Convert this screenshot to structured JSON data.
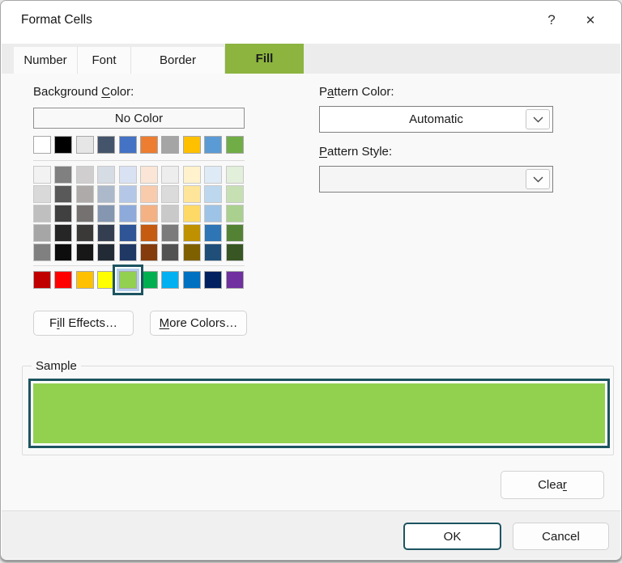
{
  "window": {
    "title": "Format Cells",
    "help_glyph": "?",
    "close_glyph": "✕"
  },
  "tabs": [
    {
      "label": "Number",
      "active": false
    },
    {
      "label": "Font",
      "active": false
    },
    {
      "label": "Border",
      "active": false
    },
    {
      "label": "Fill",
      "active": true
    }
  ],
  "fill_tab": {
    "background_color_label": {
      "pre": "Background ",
      "key": "C",
      "post": "olor:"
    },
    "no_color_label": "No Color",
    "palette": {
      "theme_row": [
        "#FFFFFF",
        "#000000",
        "#E7E6E6",
        "#44546A",
        "#4472C4",
        "#ED7D31",
        "#A5A5A5",
        "#FFC000",
        "#5B9BD5",
        "#70AD47"
      ],
      "variant_rows": [
        [
          "#F2F2F2",
          "#808080",
          "#D0CECE",
          "#D6DCE4",
          "#D9E2F3",
          "#FBE5D6",
          "#EDEDED",
          "#FFF2CC",
          "#DEEBF7",
          "#E2EFDA"
        ],
        [
          "#D9D9D9",
          "#595959",
          "#AEAAAA",
          "#ACB9CA",
          "#B4C7E7",
          "#F8CBAD",
          "#DBDBDB",
          "#FFE599",
          "#BDD7EE",
          "#C6E0B4"
        ],
        [
          "#BFBFBF",
          "#404040",
          "#757171",
          "#8496B0",
          "#8EAADB",
          "#F4B183",
          "#C9C9C9",
          "#FFD966",
          "#9DC3E6",
          "#A9D08E"
        ],
        [
          "#A6A6A6",
          "#262626",
          "#3B3838",
          "#333F50",
          "#2F5597",
          "#C55A11",
          "#7B7B7B",
          "#BF9000",
          "#2E75B6",
          "#548235"
        ],
        [
          "#808080",
          "#0D0D0D",
          "#171717",
          "#222B35",
          "#1F3864",
          "#843C0C",
          "#525252",
          "#7F6000",
          "#1F4E79",
          "#375623"
        ]
      ],
      "standard_row": [
        "#C00000",
        "#FF0000",
        "#FFC000",
        "#FFFF00",
        "#92D050",
        "#00B050",
        "#00B0F0",
        "#0070C0",
        "#002060",
        "#7030A0"
      ],
      "selected_standard_index": 4,
      "selected_color": "#92D050"
    },
    "fill_effects_label": {
      "pre": "F",
      "key": "i",
      "post": "ll Effects…"
    },
    "more_colors_label": {
      "pre": "",
      "key": "M",
      "post": "ore Colors…"
    },
    "pattern_color_label": {
      "pre": "P",
      "key": "a",
      "post": "ttern Color:"
    },
    "pattern_color_value": "Automatic",
    "pattern_style_label": {
      "pre": "",
      "key": "P",
      "post": "attern Style:"
    },
    "pattern_style_value": "",
    "sample_label": "Sample",
    "sample_fill": "#92D050"
  },
  "buttons": {
    "clear": {
      "pre": "Clea",
      "key": "r",
      "post": ""
    },
    "ok": "OK",
    "cancel": "Cancel"
  },
  "colors": {
    "active_tab_green": "#8CB43F",
    "selection_teal": "#1C5460",
    "selection_ring_blue": "#B4CFEC",
    "sample_green": "#92D050"
  }
}
